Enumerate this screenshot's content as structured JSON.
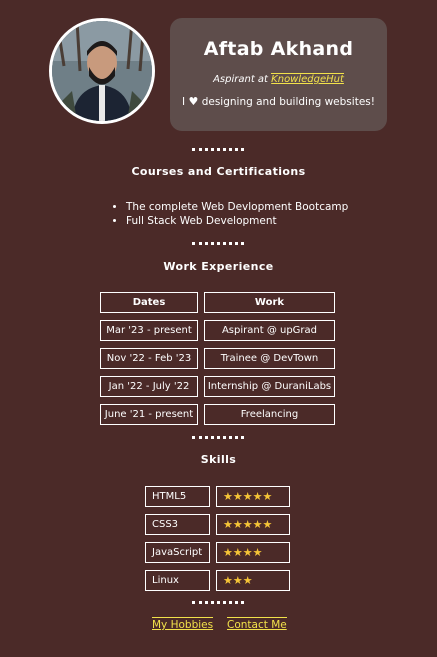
{
  "profile": {
    "name": "Aftab Akhand",
    "aspirant_prefix": "Aspirant at",
    "aspirant_link": "KnowledgeHut",
    "bio_prefix": "I",
    "bio_suffix": "designing and building websites!",
    "heart_icon": "white-heart-icon"
  },
  "courses": {
    "title": "Courses and Certifications",
    "items": [
      "The complete Web Devlopment Bootcamp",
      "Full Stack Web Development"
    ]
  },
  "work": {
    "title": "Work Experience",
    "headers": [
      "Dates",
      "Work"
    ],
    "rows": [
      {
        "dates": "Mar '23 - present",
        "work": "Aspirant @ upGrad"
      },
      {
        "dates": "Nov '22 - Feb '23",
        "work": "Trainee @ DevTown"
      },
      {
        "dates": "Jan '22 - July '22",
        "work": "Internship @ DuraniLabs"
      },
      {
        "dates": "June '21 - present",
        "work": "Freelancing"
      }
    ]
  },
  "skills": {
    "title": "Skills",
    "items": [
      {
        "name": "HTML5",
        "rating": 5,
        "stars": "★★★★★"
      },
      {
        "name": "CSS3",
        "rating": 5,
        "stars": "★★★★★"
      },
      {
        "name": "JavaScript",
        "rating": 4,
        "stars": "★★★★"
      },
      {
        "name": "Linux",
        "rating": 3,
        "stars": "★★★"
      }
    ],
    "star_color": "#f6c537"
  },
  "footer": {
    "hobbies_link": "My Hobbies",
    "contact_link": "Contact Me"
  },
  "colors": {
    "background": "#4b2a28",
    "card": "#5e4d4b",
    "link": "#f2e24a"
  }
}
